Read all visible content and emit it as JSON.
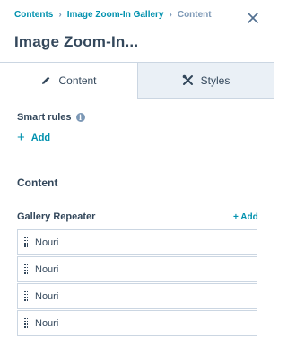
{
  "breadcrumb": {
    "items": [
      "Contents",
      "Image Zoom-In Gallery",
      "Content"
    ],
    "separator": "›"
  },
  "header": {
    "title": "Image Zoom-In..."
  },
  "tabs": [
    {
      "label": "Content",
      "icon": "pencil-icon",
      "active": true
    },
    {
      "label": "Styles",
      "icon": "wrench-screwdriver-icon",
      "active": false
    }
  ],
  "smart_rules": {
    "label": "Smart rules",
    "add_label": "Add"
  },
  "content_section": {
    "title": "Content"
  },
  "gallery_repeater": {
    "label": "Gallery Repeater",
    "add_label": "+ Add",
    "items": [
      "Nouri",
      "Nouri",
      "Nouri",
      "Nouri"
    ]
  },
  "colors": {
    "link": "#0091ae",
    "text": "#33475b",
    "border": "#cbd6e2",
    "inactive_tab": "#eaf0f6"
  }
}
